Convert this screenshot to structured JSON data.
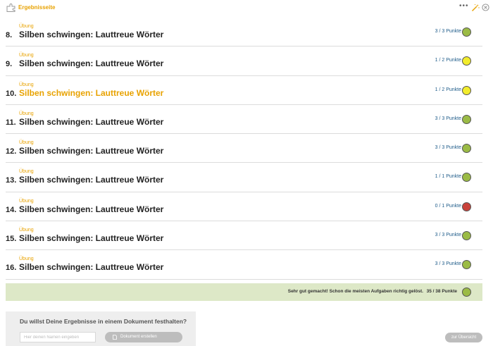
{
  "header": {
    "title": "Ergebnisseite",
    "menu_glyph": "•••",
    "icons": [
      "puzzle-icon",
      "more-icon",
      "magic-wand-icon",
      "close-icon"
    ]
  },
  "colors": {
    "accent": "#e8a200",
    "score_text": "#1f5c8a",
    "status_green": "#9bbb45",
    "status_yellow": "#f2ec2c",
    "status_red": "#c9423a",
    "summary_bg": "#dde8c7"
  },
  "exercises": [
    {
      "label": "Übung",
      "number": "8.",
      "name": "Silben schwingen: Lauttreue Wörter",
      "score": "3 / 3 Punkte",
      "status": "green",
      "active": false
    },
    {
      "label": "Übung",
      "number": "9.",
      "name": "Silben schwingen: Lauttreue Wörter",
      "score": "1 / 2 Punkte",
      "status": "yellow",
      "active": false
    },
    {
      "label": "Übung",
      "number": "10.",
      "name": "Silben schwingen: Lauttreue Wörter",
      "score": "1 / 2 Punkte",
      "status": "yellow",
      "active": true
    },
    {
      "label": "Übung",
      "number": "11.",
      "name": "Silben schwingen: Lauttreue Wörter",
      "score": "3 / 3 Punkte",
      "status": "green",
      "active": false
    },
    {
      "label": "Übung",
      "number": "12.",
      "name": "Silben schwingen: Lauttreue Wörter",
      "score": "3 / 3 Punkte",
      "status": "green",
      "active": false
    },
    {
      "label": "Übung",
      "number": "13.",
      "name": "Silben schwingen: Lauttreue Wörter",
      "score": "1 / 1 Punkte",
      "status": "green",
      "active": false
    },
    {
      "label": "Übung",
      "number": "14.",
      "name": "Silben schwingen: Lauttreue Wörter",
      "score": "0 / 1 Punkte",
      "status": "red",
      "active": false
    },
    {
      "label": "Übung",
      "number": "15.",
      "name": "Silben schwingen: Lauttreue Wörter",
      "score": "3 / 3 Punkte",
      "status": "green",
      "active": false
    },
    {
      "label": "Übung",
      "number": "16.",
      "name": "Silben schwingen: Lauttreue Wörter",
      "score": "3 / 3 Punkte",
      "status": "green",
      "active": false
    }
  ],
  "summary": {
    "message": "Sehr gut gemacht! Schon die meisten Aufgaben richtig gelöst.",
    "total": "35 / 38 Punkte",
    "status": "green"
  },
  "document": {
    "question": "Du willst Deine Ergebnisse in einem Dokument festhalten?",
    "name_placeholder": "Hier deinen Namen eingeben",
    "name_value": "",
    "create_button": "Dokument erstellen",
    "create_icon": "document-icon"
  },
  "overview_button": "zur Übersicht"
}
